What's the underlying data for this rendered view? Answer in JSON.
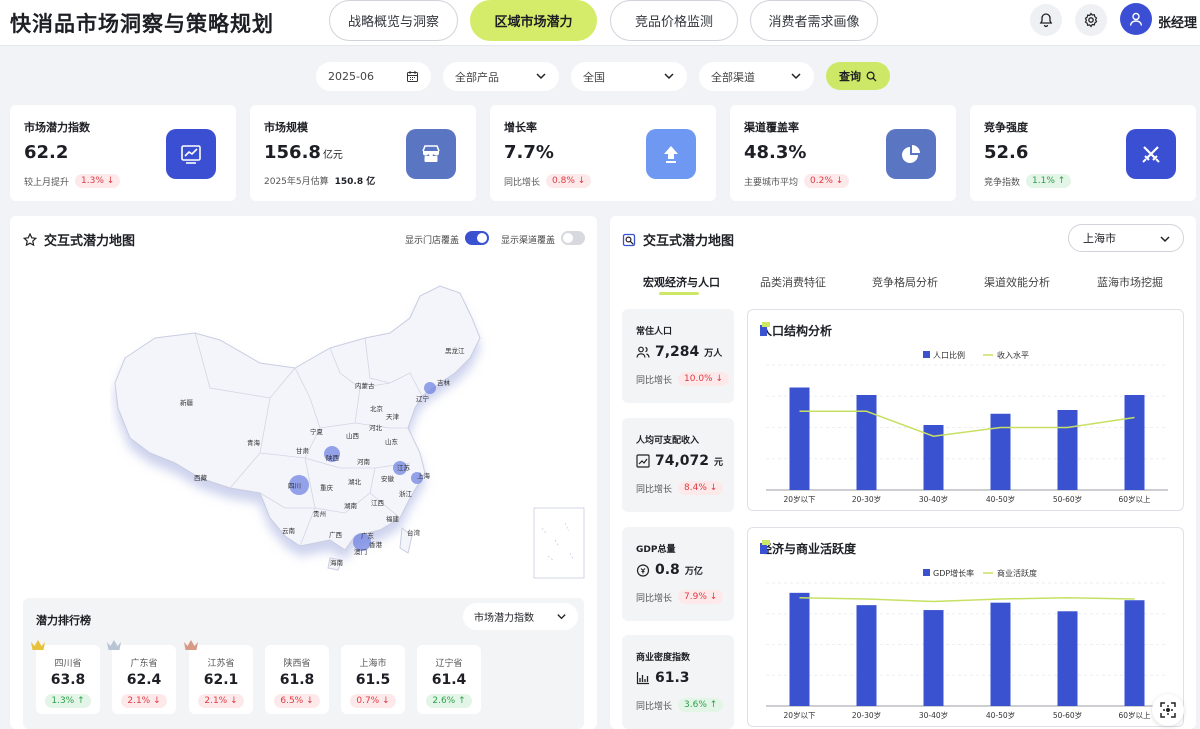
{
  "app_title": "快消品市场洞察与策略规划",
  "nav": [
    "战略概览与洞察",
    "区域市场潜力",
    "竞品价格监测",
    "消费者需求画像"
  ],
  "user": {
    "name": "张经理"
  },
  "filters": {
    "date": "2025-06",
    "product": "全部产品",
    "region": "全国",
    "channel": "全部渠道",
    "query_label": "查询"
  },
  "kpis": [
    {
      "title": "市场潜力指数",
      "value": "62.2",
      "unit": "",
      "sub": "较上月提升",
      "badge": "1.3% ↓",
      "dir": "down",
      "icon": "trend-chart-icon",
      "color": "#3b4fd2"
    },
    {
      "title": "市场规模",
      "value": "156.8",
      "unit": "亿元",
      "sub": "2025年5月估算",
      "badge": "150.8 亿",
      "dir": "none",
      "icon": "store-icon",
      "color": "#5a76c2"
    },
    {
      "title": "增长率",
      "value": "7.7%",
      "unit": "",
      "sub": "同比增长",
      "badge": "0.8% ↓",
      "dir": "down",
      "icon": "arrow-up-icon",
      "color": "#6f98f2"
    },
    {
      "title": "渠道覆盖率",
      "value": "48.3%",
      "unit": "",
      "sub": "主要城市平均",
      "badge": "0.2% ↓",
      "dir": "down",
      "icon": "pie-icon",
      "color": "#5a76c2"
    },
    {
      "title": "竞争强度",
      "value": "52.6",
      "unit": "",
      "sub": "竞争指数",
      "badge": "1.1% ↑",
      "dir": "up",
      "icon": "swords-icon",
      "color": "#3b4fd2"
    }
  ],
  "map_panel": {
    "title": "交互式潜力地图",
    "toggle_store": "显示门店覆盖",
    "toggle_store_on": true,
    "toggle_channel": "显示渠道覆盖",
    "toggle_channel_on": false,
    "provinces": [
      "黑龙江",
      "吉林",
      "辽宁",
      "内蒙古",
      "北京",
      "天津",
      "河北",
      "山西",
      "山东",
      "新疆",
      "宁夏",
      "甘肃",
      "青海",
      "陕西",
      "河南",
      "江苏",
      "上海",
      "西藏",
      "四川",
      "重庆",
      "湖北",
      "安徽",
      "浙江",
      "湖南",
      "江西",
      "贵州",
      "福建",
      "云南",
      "广西",
      "广东",
      "台湾",
      "澳门",
      "香港",
      "海南"
    ]
  },
  "ranking": {
    "title": "潜力排行榜",
    "select": "市场潜力指数",
    "items": [
      {
        "name": "四川省",
        "score": "63.8",
        "badge": "1.3% ↑",
        "dir": "up",
        "crown": "#e8c23a"
      },
      {
        "name": "广东省",
        "score": "62.4",
        "badge": "2.1% ↓",
        "dir": "down",
        "crown": "#b8c3d4"
      },
      {
        "name": "江苏省",
        "score": "62.1",
        "badge": "2.1% ↓",
        "dir": "down",
        "crown": "#d79a86"
      },
      {
        "name": "陕西省",
        "score": "61.8",
        "badge": "6.5% ↓",
        "dir": "down",
        "crown": ""
      },
      {
        "name": "上海市",
        "score": "61.5",
        "badge": "0.7% ↓",
        "dir": "down",
        "crown": ""
      },
      {
        "name": "辽宁省",
        "score": "61.4",
        "badge": "2.6% ↑",
        "dir": "up",
        "crown": ""
      }
    ]
  },
  "detail_panel": {
    "title": "交互式潜力地图",
    "city": "上海市",
    "tabs": [
      "宏观经济与人口",
      "品类消费特征",
      "竞争格局分析",
      "渠道效能分析",
      "蓝海市场挖掘"
    ],
    "active_tab": 0
  },
  "metrics": [
    {
      "title": "常住人口",
      "value": "7,284",
      "unit": "万人",
      "sub": "同比增长",
      "badge": "10.0% ↓",
      "dir": "down",
      "icon": "people-icon"
    },
    {
      "title": "人均可支配收入",
      "value": "74,072",
      "unit": "元",
      "sub": "同比增长",
      "badge": "8.4% ↓",
      "dir": "down",
      "icon": "chart-line-icon"
    },
    {
      "title": "GDP总量",
      "value": "0.8",
      "unit": "万亿",
      "sub": "同比增长",
      "badge": "7.9% ↓",
      "dir": "down",
      "icon": "money-icon"
    },
    {
      "title": "商业密度指数",
      "value": "61.3",
      "unit": "",
      "sub": "同比增长",
      "badge": "3.6% ↑",
      "dir": "up",
      "icon": "bar-icon"
    }
  ],
  "chart_data": [
    {
      "type": "bar",
      "title": "人口结构分析",
      "categories": [
        "20岁以下",
        "20-30岁",
        "30-40岁",
        "40-50岁",
        "50-60岁",
        "60岁以上"
      ],
      "series": [
        {
          "name": "人口比例",
          "kind": "bar",
          "color": "#3b52d0",
          "values": [
            82,
            76,
            52,
            61,
            64,
            76
          ]
        },
        {
          "name": "收入水平",
          "kind": "line",
          "color": "#c7e063",
          "values": [
            63,
            63,
            43,
            50,
            50,
            58
          ]
        }
      ],
      "ylim": [
        0,
        100
      ],
      "grid": true,
      "legend": "top-center"
    },
    {
      "type": "bar",
      "title": "经济与商业活跃度",
      "categories": [
        "20岁以下",
        "20-30岁",
        "30-40岁",
        "40-50岁",
        "50-60岁",
        "60岁以上"
      ],
      "series": [
        {
          "name": "GDP增长率",
          "kind": "bar",
          "color": "#3b52d0",
          "values": [
            92,
            82,
            78,
            84,
            77,
            86
          ]
        },
        {
          "name": "商业活跃度",
          "kind": "line",
          "color": "#c7e063",
          "values": [
            88,
            87,
            85,
            87,
            88,
            87
          ]
        }
      ],
      "ylim": [
        0,
        100
      ],
      "grid": true,
      "legend": "top-center"
    }
  ]
}
